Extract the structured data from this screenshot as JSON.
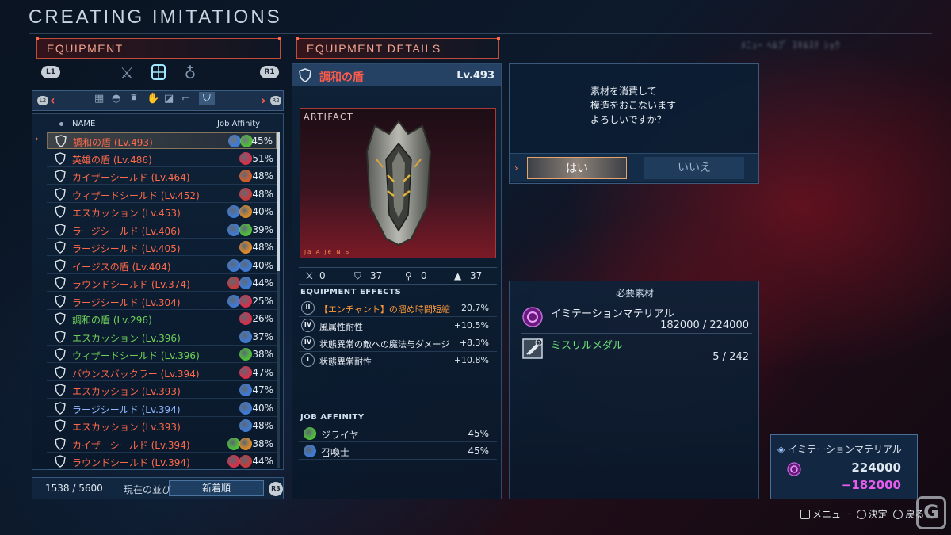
{
  "title": "CREATING IMITATIONS",
  "top_right_blurred": "ﾒﾆｭｰ  ﾍﾙﾌﾟ ｽｷﾙｽﾃ ｼｮｳ",
  "equipment_panel": {
    "header": "EQUIPMENT",
    "l1": "L1",
    "r1": "R1",
    "l2": "L2",
    "r2": "R2",
    "col_name": "NAME",
    "col_affinity": "Job Affinity",
    "items": [
      {
        "name": "調和の盾 (Lv.493)",
        "pct": "45%",
        "color": "#ff6a4a",
        "icons": [
          "#3e7bd6",
          "#4fbf3a"
        ]
      },
      {
        "name": "英雄の盾 (Lv.486)",
        "pct": "51%",
        "color": "#ff6a4a",
        "icons": [
          "#d8304a"
        ]
      },
      {
        "name": "カイザーシールド (Lv.464)",
        "pct": "48%",
        "color": "#ff6a4a",
        "icons": [
          "#d35a2a"
        ]
      },
      {
        "name": "ウィザードシールド (Lv.452)",
        "pct": "48%",
        "color": "#ff6a4a",
        "icons": [
          "#c83a3a"
        ]
      },
      {
        "name": "エスカッション (Lv.453)",
        "pct": "40%",
        "color": "#ff6a4a",
        "icons": [
          "#3e7bd6",
          "#d88a2a"
        ]
      },
      {
        "name": "ラージシールド (Lv.406)",
        "pct": "39%",
        "color": "#ff6a4a",
        "icons": [
          "#3e7bd6",
          "#4fbf3a"
        ]
      },
      {
        "name": "ラージシールド (Lv.405)",
        "pct": "48%",
        "color": "#ff6a4a",
        "icons": [
          "#e08a2a"
        ]
      },
      {
        "name": "イージスの盾 (Lv.404)",
        "pct": "40%",
        "color": "#ff6a4a",
        "icons": [
          "#3e7bd6",
          "#3e7bd6"
        ]
      },
      {
        "name": "ラウンドシールド (Lv.374)",
        "pct": "44%",
        "color": "#ff6a4a",
        "icons": [
          "#c83a3a",
          "#3e7bd6"
        ]
      },
      {
        "name": "ラージシールド (Lv.304)",
        "pct": "25%",
        "color": "#ff6a4a",
        "icons": [
          "#3e7bd6",
          "#d8304a"
        ]
      },
      {
        "name": "調和の盾 (Lv.296)",
        "pct": "26%",
        "color": "#6fd35a",
        "icons": [
          "#d8304a"
        ]
      },
      {
        "name": "エスカッション (Lv.396)",
        "pct": "37%",
        "color": "#6fd35a",
        "icons": [
          "#3e7bd6"
        ]
      },
      {
        "name": "ウィザードシールド (Lv.396)",
        "pct": "38%",
        "color": "#6fd35a",
        "icons": [
          "#4fbf3a"
        ]
      },
      {
        "name": "バウンスバックラー (Lv.394)",
        "pct": "47%",
        "color": "#ff6a4a",
        "icons": [
          "#d8304a"
        ]
      },
      {
        "name": "エスカッション (Lv.393)",
        "pct": "47%",
        "color": "#ff6a4a",
        "icons": [
          "#3e7bd6"
        ]
      },
      {
        "name": "ラージシールド (Lv.394)",
        "pct": "40%",
        "color": "#8fb6ff",
        "icons": [
          "#3e7bd6"
        ]
      },
      {
        "name": "エスカッション (Lv.393)",
        "pct": "48%",
        "color": "#ff6a4a",
        "icons": [
          "#3e7bd6"
        ]
      },
      {
        "name": "カイザーシールド (Lv.394)",
        "pct": "38%",
        "color": "#ff6a4a",
        "icons": [
          "#4fbf3a",
          "#d88a2a"
        ]
      },
      {
        "name": "ラウンドシールド (Lv.394)",
        "pct": "44%",
        "color": "#ff6a4a",
        "icons": [
          "#d8304a",
          "#c83a3a"
        ]
      }
    ],
    "count": "1538 / 5600",
    "sort_label": "現在の並び",
    "sort_value": "新着順",
    "r3": "R3"
  },
  "details": {
    "header": "EQUIPMENT DETAILS",
    "name": "調和の盾",
    "level": "Lv.493",
    "rarity": "ARTIFACT",
    "tags": "Ja A Je N S",
    "stats": [
      "0",
      "37",
      "0",
      "37"
    ],
    "effects_title": "EQUIPMENT EFFECTS",
    "effects": [
      {
        "rank": "II",
        "text": "【エンチャント】の溜め時間短縮",
        "value": "−20.7%",
        "color": "#ff9a3a"
      },
      {
        "rank": "IV",
        "text": "風属性耐性",
        "value": "+10.5%",
        "color": "#e8eef5"
      },
      {
        "rank": "IV",
        "text": "状態異常の敵への魔法与ダメージ",
        "value": "+8.3%",
        "color": "#e8eef5"
      },
      {
        "rank": "I",
        "text": "状態異常耐性",
        "value": "+10.8%",
        "color": "#e8eef5"
      }
    ],
    "affinity_title": "JOB AFFINITY",
    "affinity": [
      {
        "job": "ジライヤ",
        "pct": "45%",
        "color": "#4fbf3a"
      },
      {
        "job": "召喚士",
        "pct": "45%",
        "color": "#3e7bd6"
      }
    ]
  },
  "dialog": {
    "line1": "素材を消費して",
    "line2": "模造をおこないます",
    "line3": "よろしいですか？",
    "yes": "はい",
    "no": "いいえ"
  },
  "materials": {
    "header": "必要素材",
    "items": [
      {
        "name": "イミテーションマテリアル",
        "qty": "182000 / 224000",
        "color": "#e8eef5"
      },
      {
        "name": "ミスリルメダル",
        "qty": "5 / 242",
        "color": "#6fe07a",
        "badge": "3"
      }
    ]
  },
  "owned": {
    "title": "イミテーションマテリアル",
    "have": "224000",
    "cost": "−182000"
  },
  "hints": {
    "menu": "メニュー",
    "confirm": "決定",
    "back": "戻る"
  },
  "watermark": "G"
}
